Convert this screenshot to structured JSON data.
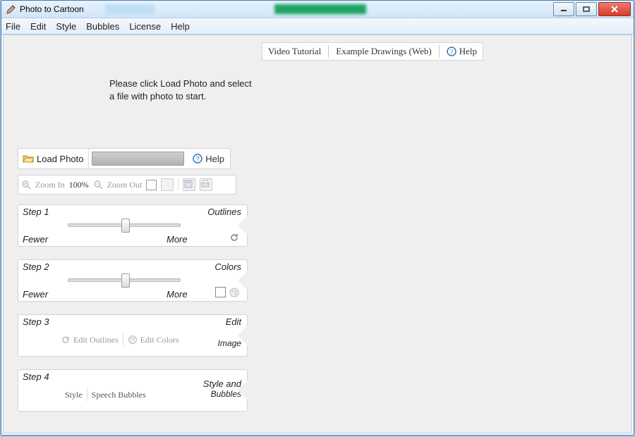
{
  "window": {
    "title": "Photo to Cartoon"
  },
  "menu": {
    "file": "File",
    "edit": "Edit",
    "style": "Style",
    "bubbles": "Bubbles",
    "license": "License",
    "help": "Help"
  },
  "topbar": {
    "video_tutorial": "Video Tutorial",
    "example_drawings": "Example Drawings (Web)",
    "help": "Help"
  },
  "instruction": "Please click Load Photo and select a file with photo to start.",
  "load": {
    "button": "Load Photo",
    "help": "Help"
  },
  "zoom": {
    "in": "Zoom In",
    "pct": "100%",
    "out": "Zoom Out"
  },
  "step1": {
    "title": "Step 1",
    "tag": "Outlines",
    "fewer": "Fewer",
    "more": "More"
  },
  "step2": {
    "title": "Step 2",
    "tag": "Colors",
    "fewer": "Fewer",
    "more": "More"
  },
  "step3": {
    "title": "Step 3",
    "edit_outlines": "Edit Outlines",
    "edit_colors": "Edit Colors",
    "tag1": "Edit",
    "tag2": "Image"
  },
  "step4": {
    "title": "Step 4",
    "style": "Style",
    "speech_bubbles": "Speech Bubbles",
    "tag1": "Style and",
    "tag2": "Bubbles"
  }
}
